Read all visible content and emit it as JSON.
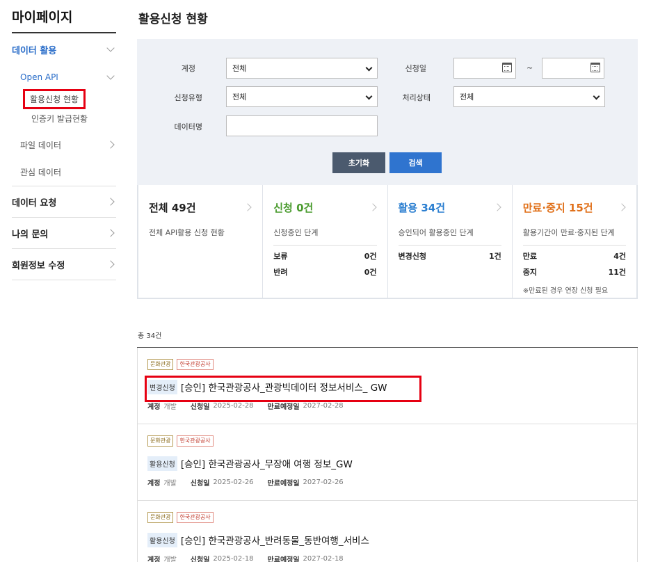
{
  "sidebar": {
    "title": "마이페이지",
    "data_usage": "데이터 활용",
    "open_api": "Open API",
    "usage_status": "활용신청 현황",
    "auth_key_status": "인증키 발급현황",
    "file_data": "파일 데이터",
    "interest_data": "관심 데이터",
    "data_request": "데이터 요청",
    "my_inquiry": "나의 문의",
    "member_edit": "회원정보 수정"
  },
  "page_title": "활용신청 현황",
  "filter": {
    "account_label": "계정",
    "account_value": "전체",
    "apply_date_label": "신청일",
    "tilde": "~",
    "apply_type_label": "신청유형",
    "apply_type_value": "전체",
    "process_status_label": "처리상태",
    "process_status_value": "전체",
    "data_name_label": "데이터명",
    "data_name_value": "",
    "reset_button": "초기화",
    "search_button": "검색"
  },
  "stats": {
    "all": {
      "label": "전체",
      "count": "49건",
      "desc": "전체 API활용 신청 현황"
    },
    "apply": {
      "label": "신청",
      "count": "0건",
      "desc": "신청중인 단계",
      "rows": [
        {
          "k": "보류",
          "v": "0건"
        },
        {
          "k": "반려",
          "v": "0건"
        }
      ]
    },
    "use": {
      "label": "활용",
      "count": "34건",
      "desc": "승인되어 활용중인 단계",
      "rows": [
        {
          "k": "변경신청",
          "v": "1건"
        }
      ]
    },
    "expire": {
      "label": "만료·중지",
      "count": "15건",
      "desc": "활용기간이 만료·중지된 단계",
      "rows": [
        {
          "k": "만료",
          "v": "4건"
        },
        {
          "k": "중지",
          "v": "11건"
        }
      ],
      "note": "※만료된 경우 연장 신청 필요"
    }
  },
  "total_text": "총 34건",
  "items": [
    {
      "tag1": "문화관광",
      "tag2": "한국관광공사",
      "kind": "변경신청",
      "title": "[승인] 한국관광공사_관광빅데이터 정보서비스_ GW",
      "account_label": "계정",
      "account": "개발",
      "apply_label": "신청일",
      "apply_date": "2025-02-28",
      "expire_label": "만료예정일",
      "expire_date": "2027-02-28"
    },
    {
      "tag1": "문화관광",
      "tag2": "한국관광공사",
      "kind": "활용신청",
      "title": "[승인] 한국관광공사_무장애 여행 정보_GW",
      "account_label": "계정",
      "account": "개발",
      "apply_label": "신청일",
      "apply_date": "2025-02-26",
      "expire_label": "만료예정일",
      "expire_date": "2027-02-26"
    },
    {
      "tag1": "문화관광",
      "tag2": "한국관광공사",
      "kind": "활용신청",
      "title": "[승인] 한국관광공사_반려동물_동반여행_서비스",
      "account_label": "계정",
      "account": "개발",
      "apply_label": "신청일",
      "apply_date": "2025-02-18",
      "expire_label": "만료예정일",
      "expire_date": "2027-02-18"
    }
  ]
}
